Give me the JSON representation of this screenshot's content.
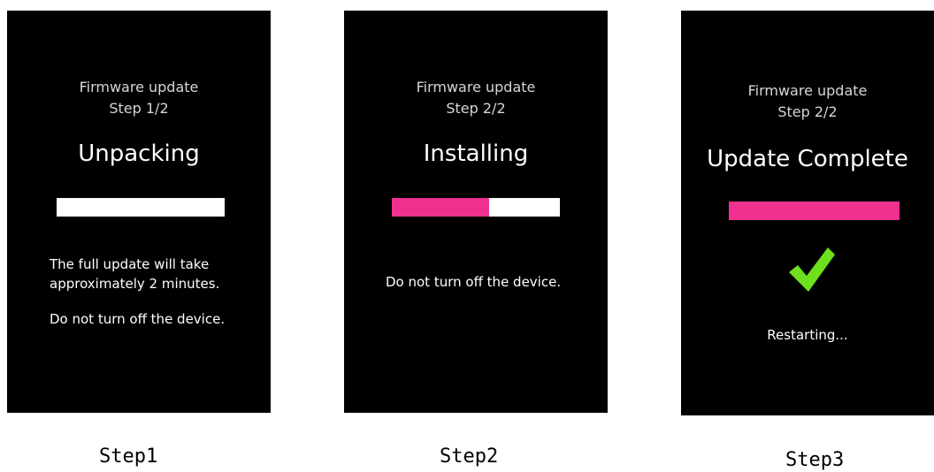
{
  "panels": [
    {
      "title": "Firmware update",
      "step": "Step 1/2",
      "status": "Unpacking",
      "progress": 0,
      "messages": [
        "The full update will take",
        "approximately 2 minutes.",
        "Do not turn off the device."
      ],
      "caption": "Step1"
    },
    {
      "title": "Firmware update",
      "step": "Step 2/2",
      "status": "Installing",
      "progress": 0.58,
      "messages": [
        "Do not turn off the device."
      ],
      "caption": "Step2"
    },
    {
      "title": "Firmware update",
      "step": "Step 2/2",
      "status": "Update Complete",
      "progress": 1.0,
      "icon": "checkmark-icon",
      "messages": [
        "Restarting..."
      ],
      "caption": "Step3"
    }
  ],
  "colors": {
    "screen_bg": "#000000",
    "progress_fill": "#f0318f",
    "progress_track": "#ffffff",
    "checkmark": "#6ee01c",
    "title_text": "#d6d6d6"
  }
}
